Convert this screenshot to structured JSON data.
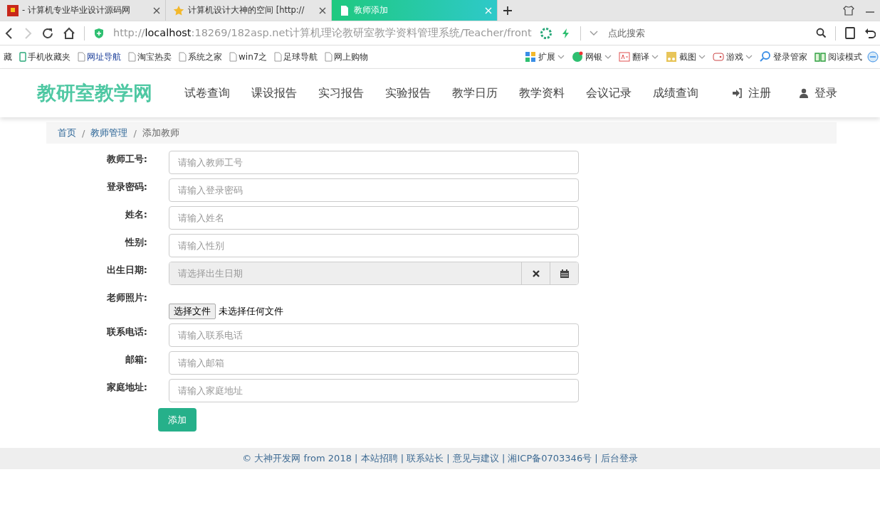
{
  "browser": {
    "tabs": [
      {
        "title": "- 计算机专业毕业设计源码网",
        "selected": false
      },
      {
        "title": "计算机设计大神的空间 [http://",
        "selected": false
      },
      {
        "title": "教师添加",
        "selected": true
      }
    ],
    "url": "http://**localhost**:18269/182asp.net计算机理论教研室教学资料管理系统/Teacher/front",
    "search": {
      "placeholder": "点此搜索"
    },
    "bookmarks": [
      "藏",
      "手机收藏夹",
      "网址导航",
      "淘宝热卖",
      "系统之家",
      "win7之",
      "足球导航",
      "网上购物"
    ],
    "tools": [
      "扩展",
      "网银",
      "翻译",
      "截图",
      "游戏",
      "登录管家",
      "阅读模式"
    ]
  },
  "site": {
    "brand": "教研室教学网",
    "nav": [
      "试卷查询",
      "课设报告",
      "实习报告",
      "实验报告",
      "教学日历",
      "教学资料",
      "会议记录",
      "成绩查询"
    ],
    "register": "注册",
    "login": "登录"
  },
  "breadcrumb": {
    "separator": "/",
    "items": [
      {
        "label": "首页",
        "link": true
      },
      {
        "label": "教师管理",
        "link": true
      },
      {
        "label": "添加教师",
        "link": false
      }
    ]
  },
  "form": {
    "fields": [
      {
        "kind": "text",
        "label": "教师工号:",
        "placeholder": "请输入教师工号"
      },
      {
        "kind": "text",
        "label": "登录密码:",
        "placeholder": "请输入登录密码"
      },
      {
        "kind": "text",
        "label": "姓名:",
        "placeholder": "请输入姓名"
      },
      {
        "kind": "text",
        "label": "性别:",
        "placeholder": "请输入性别"
      },
      {
        "kind": "date",
        "label": "出生日期:",
        "placeholder": "请选择出生日期"
      },
      {
        "kind": "file",
        "label": "老师照片:",
        "button": "选择文件",
        "status": "未选择任何文件"
      },
      {
        "kind": "text",
        "label": "联系电话:",
        "placeholder": "请输入联系电话"
      },
      {
        "kind": "text",
        "label": "邮箱:",
        "placeholder": "请输入邮箱"
      },
      {
        "kind": "text",
        "label": "家庭地址:",
        "placeholder": "请输入家庭地址"
      }
    ],
    "submit": "添加"
  },
  "footer": "© 大神开发网 from 2018 | 本站招聘 | 联系站长 | 意见与建议 | 湘ICP备0703346号 | 后台登录"
}
